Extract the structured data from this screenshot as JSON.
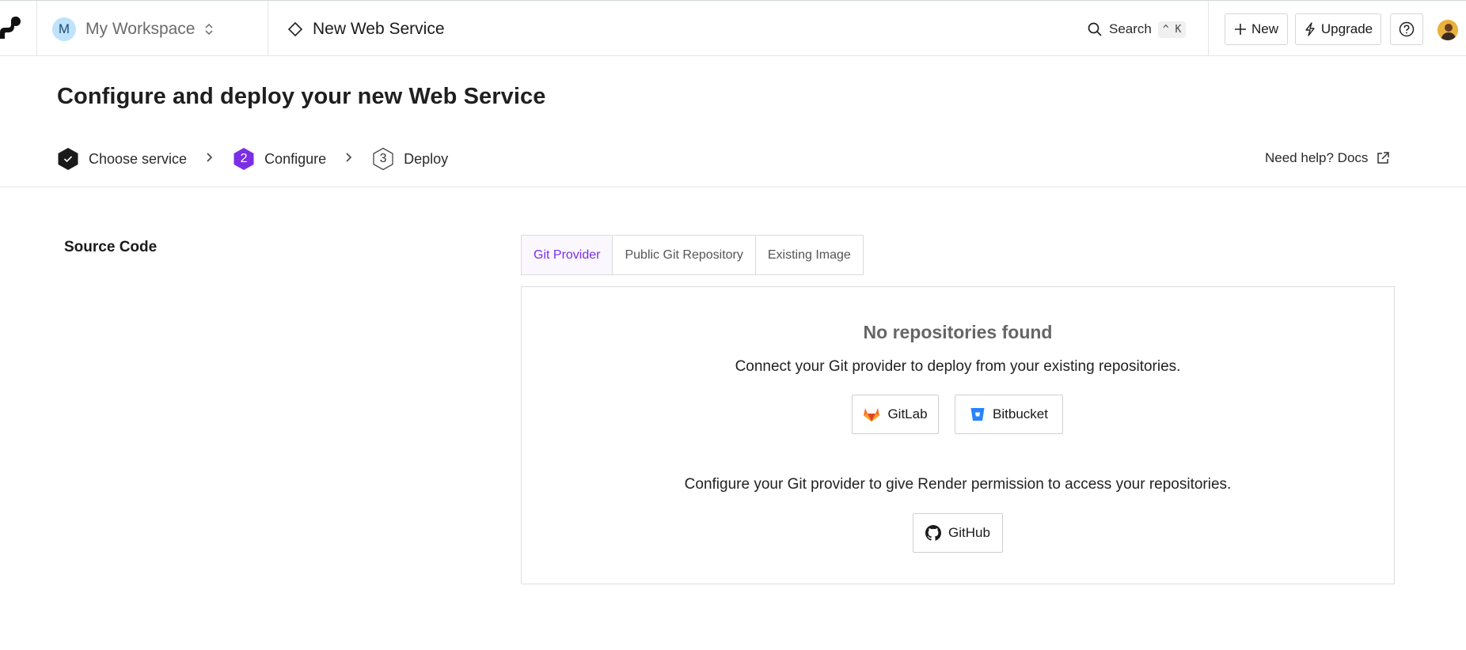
{
  "topbar": {
    "workspace": {
      "initial": "M",
      "name": "My Workspace"
    },
    "breadcrumb": {
      "label": "New Web Service"
    },
    "search": {
      "label": "Search",
      "shortcut": "^ K"
    },
    "new_button": "New",
    "upgrade_button": "Upgrade",
    "icons": [
      "logo-icon",
      "chevron-updown-icon",
      "diamond-icon",
      "search-icon",
      "plus-icon",
      "lightning-icon",
      "help-icon"
    ]
  },
  "header": {
    "title": "Configure and deploy your new Web Service",
    "steps": [
      {
        "number": "",
        "label": "Choose service",
        "state": "done"
      },
      {
        "number": "2",
        "label": "Configure",
        "state": "active"
      },
      {
        "number": "3",
        "label": "Deploy",
        "state": "pending"
      }
    ],
    "help_link": "Need help? Docs"
  },
  "source": {
    "title": "Source Code",
    "tabs": [
      {
        "label": "Git Provider",
        "active": true
      },
      {
        "label": "Public Git Repository",
        "active": false
      },
      {
        "label": "Existing Image",
        "active": false
      }
    ],
    "panel": {
      "title": "No repositories found",
      "connect_text": "Connect your Git provider to deploy from your existing repositories.",
      "gitlab_button": "GitLab",
      "bitbucket_button": "Bitbucket",
      "configure_text": "Configure your Git provider to give Render permission to access your repositories.",
      "github_button": "GitHub"
    }
  },
  "colors": {
    "accent": "#7b2ee6",
    "step_done": "#1a1a1a",
    "gitlab": "#e24329",
    "bitbucket": "#2684ff"
  }
}
